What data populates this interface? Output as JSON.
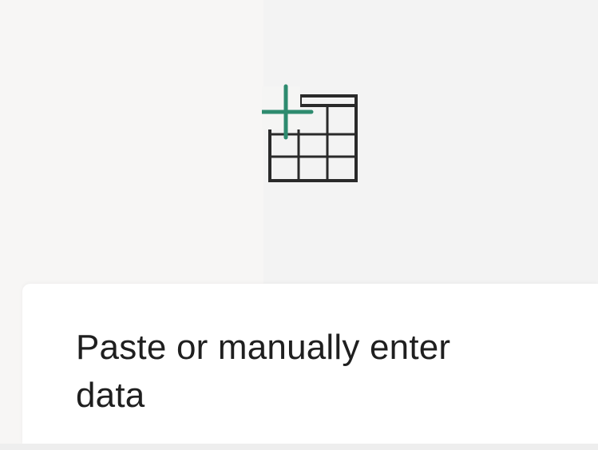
{
  "card": {
    "caption": "Paste or manually enter data",
    "icon": "table-add-icon"
  },
  "colors": {
    "accent": "#2e8b6f",
    "grid": "#2a2a2a",
    "text": "#1f1f1f",
    "panel": "#ffffff"
  }
}
